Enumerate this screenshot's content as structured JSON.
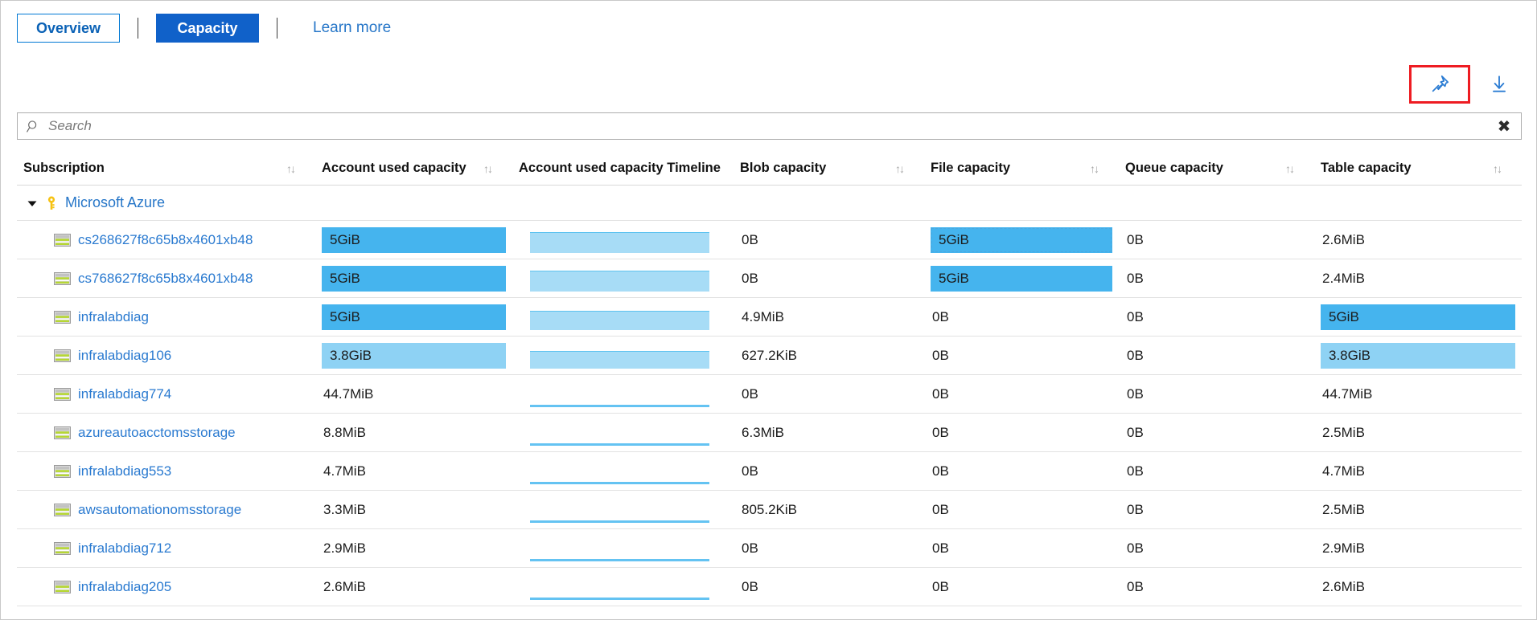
{
  "header": {
    "tabs": [
      {
        "label": "Overview",
        "style": "outline",
        "name": "tab-overview"
      },
      {
        "label": "Capacity",
        "style": "filled",
        "name": "tab-capacity"
      }
    ],
    "learn_more": "Learn more"
  },
  "commands": {
    "pin_icon": "pin-icon",
    "download_icon": "download-icon",
    "highlight_color": "#ee1c22"
  },
  "search": {
    "placeholder": "Search",
    "value": "",
    "icon": "search-icon",
    "clear_label": "✖"
  },
  "table": {
    "sort_icon": "↑↓",
    "columns": [
      {
        "label": "Subscription",
        "sortable": true
      },
      {
        "label": "Account used capacity",
        "sortable": true
      },
      {
        "label": "Account used capacity Timeline",
        "sortable": false
      },
      {
        "label": "Blob capacity",
        "sortable": true
      },
      {
        "label": "File capacity",
        "sortable": true
      },
      {
        "label": "Queue capacity",
        "sortable": true
      },
      {
        "label": "Table capacity",
        "sortable": true
      }
    ],
    "group": {
      "label": "Microsoft Azure",
      "expanded": true,
      "chevron_icon": "chevron-down-icon",
      "key_icon": "key-icon"
    },
    "rows": [
      {
        "name": "cs268627f8c65b8x4601xb48",
        "used": "5GiB",
        "used_bar": 100,
        "used_shade": "dark",
        "timeline": "block",
        "timeline_height": 26,
        "blob": "0B",
        "file": "5GiB",
        "file_bar": 100,
        "file_shade": "dark",
        "file_focus": true,
        "queue": "0B",
        "table": "2.6MiB",
        "table_bar": 0
      },
      {
        "name": "cs768627f8c65b8x4601xb48",
        "used": "5GiB",
        "used_bar": 100,
        "used_shade": "dark",
        "timeline": "block",
        "timeline_height": 26,
        "blob": "0B",
        "file": "5GiB",
        "file_bar": 100,
        "file_shade": "dark",
        "file_focus": false,
        "queue": "0B",
        "table": "2.4MiB",
        "table_bar": 0
      },
      {
        "name": "infralabdiag",
        "used": "5GiB",
        "used_bar": 100,
        "used_shade": "dark",
        "timeline": "block",
        "timeline_height": 24,
        "blob": "4.9MiB",
        "file": "0B",
        "file_bar": 0,
        "queue": "0B",
        "table": "5GiB",
        "table_bar": 100,
        "table_shade": "dark"
      },
      {
        "name": "infralabdiag106",
        "used": "3.8GiB",
        "used_bar": 100,
        "used_shade": "light",
        "timeline": "block",
        "timeline_height": 22,
        "blob": "627.2KiB",
        "file": "0B",
        "file_bar": 0,
        "queue": "0B",
        "table": "3.8GiB",
        "table_bar": 100,
        "table_shade": "light"
      },
      {
        "name": "infralabdiag774",
        "used": "44.7MiB",
        "used_bar": 0,
        "timeline": "line",
        "blob": "0B",
        "file": "0B",
        "file_bar": 0,
        "queue": "0B",
        "table": "44.7MiB",
        "table_bar": 0
      },
      {
        "name": "azureautoacctomsstorage",
        "used": "8.8MiB",
        "used_bar": 0,
        "timeline": "line",
        "blob": "6.3MiB",
        "file": "0B",
        "file_bar": 0,
        "queue": "0B",
        "table": "2.5MiB",
        "table_bar": 0
      },
      {
        "name": "infralabdiag553",
        "used": "4.7MiB",
        "used_bar": 0,
        "timeline": "line",
        "blob": "0B",
        "file": "0B",
        "file_bar": 0,
        "queue": "0B",
        "table": "4.7MiB",
        "table_bar": 0
      },
      {
        "name": "awsautomationomsstorage",
        "used": "3.3MiB",
        "used_bar": 0,
        "timeline": "line",
        "blob": "805.2KiB",
        "file": "0B",
        "file_bar": 0,
        "queue": "0B",
        "table": "2.5MiB",
        "table_bar": 0
      },
      {
        "name": "infralabdiag712",
        "used": "2.9MiB",
        "used_bar": 0,
        "timeline": "line",
        "blob": "0B",
        "file": "0B",
        "file_bar": 0,
        "queue": "0B",
        "table": "2.9MiB",
        "table_bar": 0
      },
      {
        "name": "infralabdiag205",
        "used": "2.6MiB",
        "used_bar": 0,
        "timeline": "line",
        "blob": "0B",
        "file": "0B",
        "file_bar": 0,
        "queue": "0B",
        "table": "2.6MiB",
        "table_bar": 0
      }
    ]
  },
  "colors": {
    "bar_dark": "#45b4ee",
    "bar_light": "#8ed2f4",
    "timeline_fill": "#a7dcf6",
    "timeline_line": "#64c3f2",
    "link": "#2a7ad0",
    "accent": "#1061c9"
  }
}
